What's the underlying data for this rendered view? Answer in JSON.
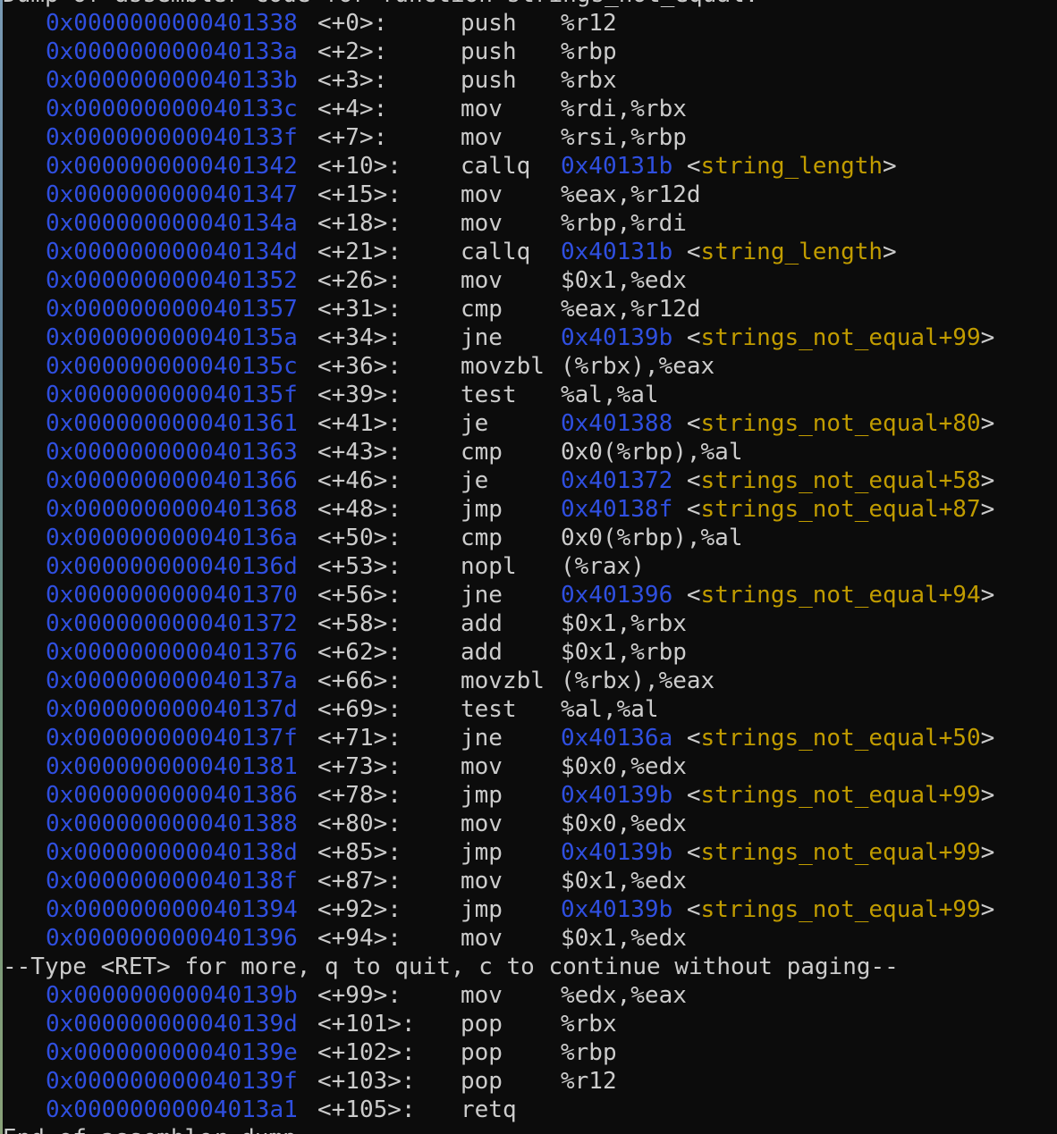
{
  "header": "Dump of assembler code for function strings_not_equal:",
  "footer": "End of assembler dump.",
  "pager_prompt": "--Type <RET> for more, q to quit, c to continue without paging--",
  "colors": {
    "background": "#0c0c0c",
    "address": "#2f4fe0",
    "symbol": "#c19c00",
    "text": "#cccccc"
  },
  "rows1": [
    {
      "addr": "0x0000000000401338",
      "off": "<+0>:",
      "mn": "push",
      "ops": "%r12"
    },
    {
      "addr": "0x000000000040133a",
      "off": "<+2>:",
      "mn": "push",
      "ops": "%rbp"
    },
    {
      "addr": "0x000000000040133b",
      "off": "<+3>:",
      "mn": "push",
      "ops": "%rbx"
    },
    {
      "addr": "0x000000000040133c",
      "off": "<+4>:",
      "mn": "mov",
      "ops": "%rdi,%rbx"
    },
    {
      "addr": "0x000000000040133f",
      "off": "<+7>:",
      "mn": "mov",
      "ops": "%rsi,%rbp"
    },
    {
      "addr": "0x0000000000401342",
      "off": "<+10>:",
      "mn": "callq",
      "jaddr": "0x40131b",
      "sym": "string_length"
    },
    {
      "addr": "0x0000000000401347",
      "off": "<+15>:",
      "mn": "mov",
      "ops": "%eax,%r12d"
    },
    {
      "addr": "0x000000000040134a",
      "off": "<+18>:",
      "mn": "mov",
      "ops": "%rbp,%rdi"
    },
    {
      "addr": "0x000000000040134d",
      "off": "<+21>:",
      "mn": "callq",
      "jaddr": "0x40131b",
      "sym": "string_length"
    },
    {
      "addr": "0x0000000000401352",
      "off": "<+26>:",
      "mn": "mov",
      "ops": "$0x1,%edx"
    },
    {
      "addr": "0x0000000000401357",
      "off": "<+31>:",
      "mn": "cmp",
      "ops": "%eax,%r12d"
    },
    {
      "addr": "0x000000000040135a",
      "off": "<+34>:",
      "mn": "jne",
      "jaddr": "0x40139b",
      "sym": "strings_not_equal+99"
    },
    {
      "addr": "0x000000000040135c",
      "off": "<+36>:",
      "mn": "movzbl",
      "ops": "(%rbx),%eax"
    },
    {
      "addr": "0x000000000040135f",
      "off": "<+39>:",
      "mn": "test",
      "ops": "%al,%al"
    },
    {
      "addr": "0x0000000000401361",
      "off": "<+41>:",
      "mn": "je",
      "jaddr": "0x401388",
      "sym": "strings_not_equal+80"
    },
    {
      "addr": "0x0000000000401363",
      "off": "<+43>:",
      "mn": "cmp",
      "ops": "0x0(%rbp),%al"
    },
    {
      "addr": "0x0000000000401366",
      "off": "<+46>:",
      "mn": "je",
      "jaddr": "0x401372",
      "sym": "strings_not_equal+58"
    },
    {
      "addr": "0x0000000000401368",
      "off": "<+48>:",
      "mn": "jmp",
      "jaddr": "0x40138f",
      "sym": "strings_not_equal+87"
    },
    {
      "addr": "0x000000000040136a",
      "off": "<+50>:",
      "mn": "cmp",
      "ops": "0x0(%rbp),%al"
    },
    {
      "addr": "0x000000000040136d",
      "off": "<+53>:",
      "mn": "nopl",
      "ops": "(%rax)"
    },
    {
      "addr": "0x0000000000401370",
      "off": "<+56>:",
      "mn": "jne",
      "jaddr": "0x401396",
      "sym": "strings_not_equal+94"
    },
    {
      "addr": "0x0000000000401372",
      "off": "<+58>:",
      "mn": "add",
      "ops": "$0x1,%rbx"
    },
    {
      "addr": "0x0000000000401376",
      "off": "<+62>:",
      "mn": "add",
      "ops": "$0x1,%rbp"
    },
    {
      "addr": "0x000000000040137a",
      "off": "<+66>:",
      "mn": "movzbl",
      "ops": "(%rbx),%eax"
    },
    {
      "addr": "0x000000000040137d",
      "off": "<+69>:",
      "mn": "test",
      "ops": "%al,%al"
    },
    {
      "addr": "0x000000000040137f",
      "off": "<+71>:",
      "mn": "jne",
      "jaddr": "0x40136a",
      "sym": "strings_not_equal+50"
    },
    {
      "addr": "0x0000000000401381",
      "off": "<+73>:",
      "mn": "mov",
      "ops": "$0x0,%edx"
    },
    {
      "addr": "0x0000000000401386",
      "off": "<+78>:",
      "mn": "jmp",
      "jaddr": "0x40139b",
      "sym": "strings_not_equal+99"
    },
    {
      "addr": "0x0000000000401388",
      "off": "<+80>:",
      "mn": "mov",
      "ops": "$0x0,%edx"
    },
    {
      "addr": "0x000000000040138d",
      "off": "<+85>:",
      "mn": "jmp",
      "jaddr": "0x40139b",
      "sym": "strings_not_equal+99"
    },
    {
      "addr": "0x000000000040138f",
      "off": "<+87>:",
      "mn": "mov",
      "ops": "$0x1,%edx"
    },
    {
      "addr": "0x0000000000401394",
      "off": "<+92>:",
      "mn": "jmp",
      "jaddr": "0x40139b",
      "sym": "strings_not_equal+99"
    },
    {
      "addr": "0x0000000000401396",
      "off": "<+94>:",
      "mn": "mov",
      "ops": "$0x1,%edx"
    }
  ],
  "rows2": [
    {
      "addr": "0x000000000040139b",
      "off": "<+99>:",
      "mn": "mov",
      "ops": "%edx,%eax"
    },
    {
      "addr": "0x000000000040139d",
      "off": "<+101>:",
      "mn": "pop",
      "ops": "%rbx"
    },
    {
      "addr": "0x000000000040139e",
      "off": "<+102>:",
      "mn": "pop",
      "ops": "%rbp"
    },
    {
      "addr": "0x000000000040139f",
      "off": "<+103>:",
      "mn": "pop",
      "ops": "%r12"
    },
    {
      "addr": "0x00000000004013a1",
      "off": "<+105>:",
      "mn": "retq",
      "ops": ""
    }
  ]
}
